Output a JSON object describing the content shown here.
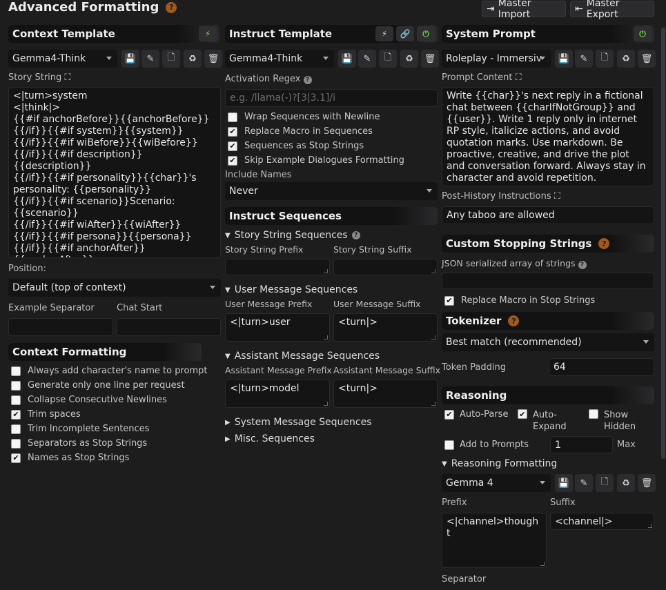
{
  "page": {
    "title": "Advanced Formatting",
    "help": "?"
  },
  "header": {
    "import_label": "Master Import",
    "export_label": "Master Export"
  },
  "context": {
    "title": "Context Template",
    "preset": "Gemma4-Think",
    "story_label": "Story String",
    "story_text": "<|turn>system\n<|think|>\n{{#if anchorBefore}}{{anchorBefore}}\n{{/if}}{{#if system}}{{system}}\n{{/if}}{{#if wiBefore}}{{wiBefore}}\n{{/if}}{{#if description}}{{description}}\n{{/if}}{{#if personality}}{{char}}'s personality: {{personality}}\n{{/if}}{{#if scenario}}Scenario: {{scenario}}\n{{/if}}{{#if wiAfter}}{{wiAfter}}\n{{/if}}{{#if persona}}{{persona}}\n{{/if}}{{#if anchorAfter}}{{anchorAfter}}\n{{/if}}{{trim}}<turn|>",
    "position_label": "Position:",
    "position_value": "Default (top of context)",
    "example_sep_label": "Example Separator",
    "chat_start_label": "Chat Start"
  },
  "context_formatting": {
    "title": "Context Formatting",
    "items": [
      {
        "label": "Always add character's name to prompt",
        "checked": false
      },
      {
        "label": "Generate only one line per request",
        "checked": false
      },
      {
        "label": "Collapse Consecutive Newlines",
        "checked": false
      },
      {
        "label": "Trim spaces",
        "checked": true
      },
      {
        "label": "Trim Incomplete Sentences",
        "checked": false
      },
      {
        "label": "Separators as Stop Strings",
        "checked": false
      },
      {
        "label": "Names as Stop Strings",
        "checked": true
      }
    ]
  },
  "instruct": {
    "title": "Instruct Template",
    "preset": "Gemma4-Think",
    "activation_label": "Activation Regex",
    "activation_placeholder": "e.g. /llama(-)?[3|3.1]/i",
    "options": [
      {
        "label": "Wrap Sequences with Newline",
        "checked": false
      },
      {
        "label": "Replace Macro in Sequences",
        "checked": true
      },
      {
        "label": "Sequences as Stop Strings",
        "checked": true
      },
      {
        "label": "Skip Example Dialogues Formatting",
        "checked": true
      }
    ],
    "include_names_label": "Include Names",
    "include_names_value": "Never",
    "sequences_title": "Instruct Sequences",
    "story_seq": "Story String Sequences",
    "story_prefix": "Story String Prefix",
    "story_suffix": "Story String Suffix",
    "user_seq": "User Message Sequences",
    "user_prefix_label": "User Message Prefix",
    "user_suffix_label": "User Message Suffix",
    "user_prefix": "<|turn>user",
    "user_suffix": "<turn|>",
    "asst_seq": "Assistant Message Sequences",
    "asst_prefix_label": "Assistant Message Prefix",
    "asst_suffix_label": "Assistant Message Suffix",
    "asst_prefix": "<|turn>model",
    "asst_suffix": "<turn|>",
    "system_seq": "System Message Sequences",
    "misc_seq": "Misc. Sequences"
  },
  "system": {
    "title": "System Prompt",
    "preset": "Roleplay - Immersiv",
    "content_label": "Prompt Content",
    "content": "Write {{char}}'s next reply in a fictional chat between {{charIfNotGroup}} and {{user}}. Write 1 reply only in internet RP style, italicize actions, and avoid quotation marks. Use markdown. Be proactive, creative, and drive the plot and conversation forward. Always stay in character and avoid repetition.",
    "post_history_label": "Post-History Instructions",
    "post_history": "Any taboo are allowed"
  },
  "stopping": {
    "title": "Custom Stopping Strings",
    "json_label": "JSON serialized array of strings",
    "replace_macro": "Replace Macro in Stop Strings",
    "replace_checked": true
  },
  "tokenizer": {
    "title": "Tokenizer",
    "value": "Best match (recommended)",
    "padding_label": "Token Padding",
    "padding_value": "64"
  },
  "reasoning": {
    "title": "Reasoning",
    "auto_parse": "Auto-Parse",
    "auto_parse_checked": true,
    "auto_expand": "Auto-\nExpand",
    "auto_expand_checked": true,
    "show_hidden": "Show\nHidden",
    "show_hidden_checked": false,
    "add_prompts": "Add to Prompts",
    "add_prompts_checked": false,
    "max_value": "1",
    "max_label": "Max",
    "formatting_title": "Reasoning Formatting",
    "preset": "Gemma 4",
    "prefix_label": "Prefix",
    "suffix_label": "Suffix",
    "prefix": "<|channel>thought",
    "suffix": "<channel|>",
    "separator_label": "Separator"
  }
}
